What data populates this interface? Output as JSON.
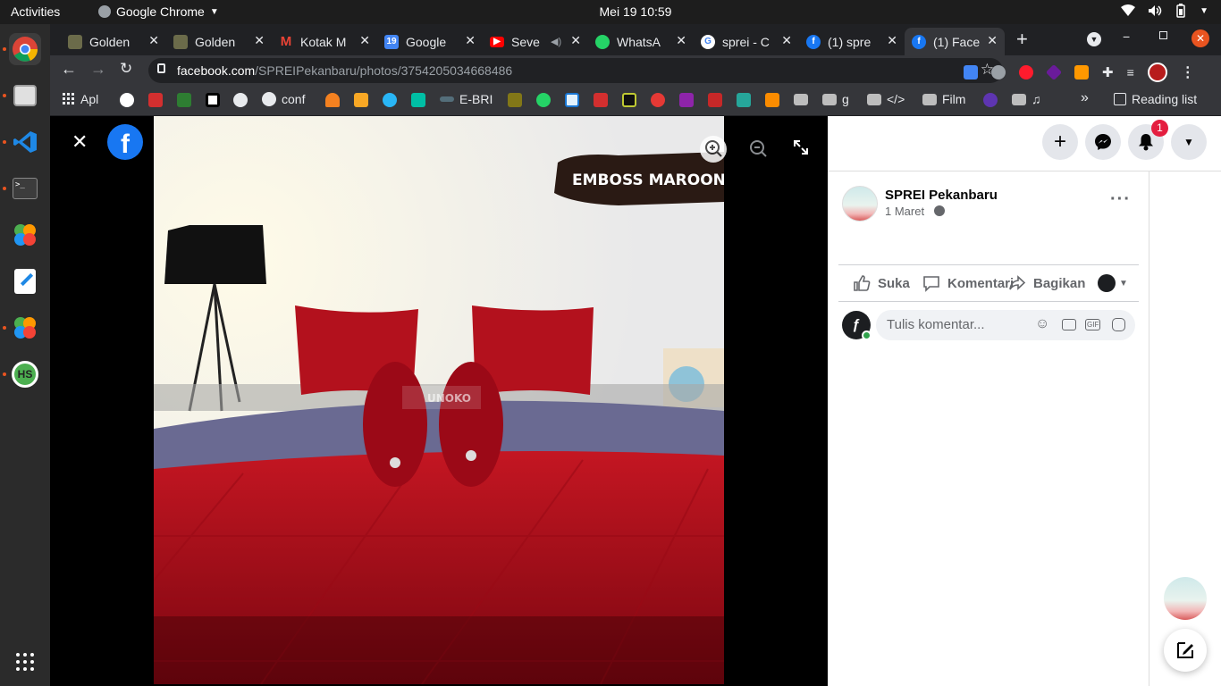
{
  "system": {
    "activities": "Activities",
    "app_name": "Google Chrome",
    "clock": "Mei 19  10:59"
  },
  "tabs": [
    {
      "title": "Golden",
      "color": "#6b6b4a"
    },
    {
      "title": "Golden",
      "color": "#6b6b4a"
    },
    {
      "title": "Kotak M",
      "color": "#ea4335"
    },
    {
      "title": "Google",
      "color": "#4285f4"
    },
    {
      "title": "Seve",
      "color": "#ff0000"
    },
    {
      "title": "WhatsA",
      "color": "#25d366"
    },
    {
      "title": "sprei - C",
      "color": "#ffffff"
    },
    {
      "title": "(1) spre",
      "color": "#1877f2"
    },
    {
      "title": "(1) Face",
      "color": "#1877f2"
    }
  ],
  "address": {
    "domain": "facebook.com",
    "path": "/SPREIPekanbaru/photos/3754205034668486"
  },
  "bookmarks": {
    "apps": "Apl",
    "conf": "conf",
    "ebri": "E-BRI",
    "g": "g",
    "code": "</>",
    "film": "Film",
    "music": "♫",
    "reading_list": "Reading list"
  },
  "photo": {
    "banner": "EMBOSS MAROON",
    "watermark": "UNOKO"
  },
  "facebook": {
    "notification_count": "1",
    "page_name": "SPREI Pekanbaru",
    "post_date": "1 Maret",
    "like": "Suka",
    "comment": "Komentari",
    "share": "Bagikan",
    "comment_placeholder": "Tulis komentar..."
  },
  "colors": {
    "fb_blue": "#1877f2",
    "chrome_dark": "#202124",
    "chrome_toolbar": "#35363a",
    "badge_red": "#e41e3f"
  }
}
